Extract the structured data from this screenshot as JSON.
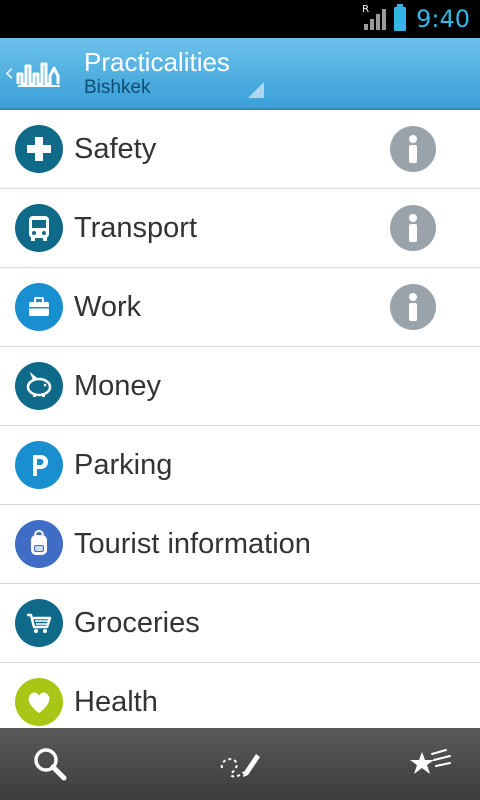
{
  "status_bar": {
    "time": "9:40",
    "roaming_indicator": "R"
  },
  "action_bar": {
    "title": "Practicalities",
    "subtitle": "Bishkek",
    "up_icon": "chevron-left-icon",
    "app_icon": "city-skyline-icon"
  },
  "list": {
    "items": [
      {
        "label": "Safety",
        "icon": "plus-cross-icon",
        "color": "#0f6a8a",
        "has_info": true
      },
      {
        "label": "Transport",
        "icon": "bus-icon",
        "color": "#0f6a8a",
        "has_info": true
      },
      {
        "label": "Work",
        "icon": "briefcase-icon",
        "color": "#1a8fd0",
        "has_info": true
      },
      {
        "label": "Money",
        "icon": "piggy-bank-icon",
        "color": "#0f6a8a",
        "has_info": false
      },
      {
        "label": "Parking",
        "icon": "parking-icon",
        "color": "#1a8fd0",
        "has_info": false
      },
      {
        "label": "Tourist information",
        "icon": "backpack-icon",
        "color": "#3f6cc4",
        "has_info": false
      },
      {
        "label": "Groceries",
        "icon": "shopping-cart-icon",
        "color": "#0f6a8a",
        "has_info": false
      },
      {
        "label": "Health",
        "icon": "heart-icon",
        "color": "#a7c615",
        "has_info": false
      }
    ],
    "info_icon": "info-icon"
  },
  "bottom_bar": {
    "buttons": [
      {
        "icon": "search-icon"
      },
      {
        "icon": "pencil-route-icon"
      },
      {
        "icon": "favorites-stars-icon"
      }
    ]
  },
  "colors": {
    "action_bar": "#3a9fd8",
    "status_time": "#33b5e5",
    "info_button": "#9aa3a9",
    "bottom_bar": "#4a4a4a"
  }
}
